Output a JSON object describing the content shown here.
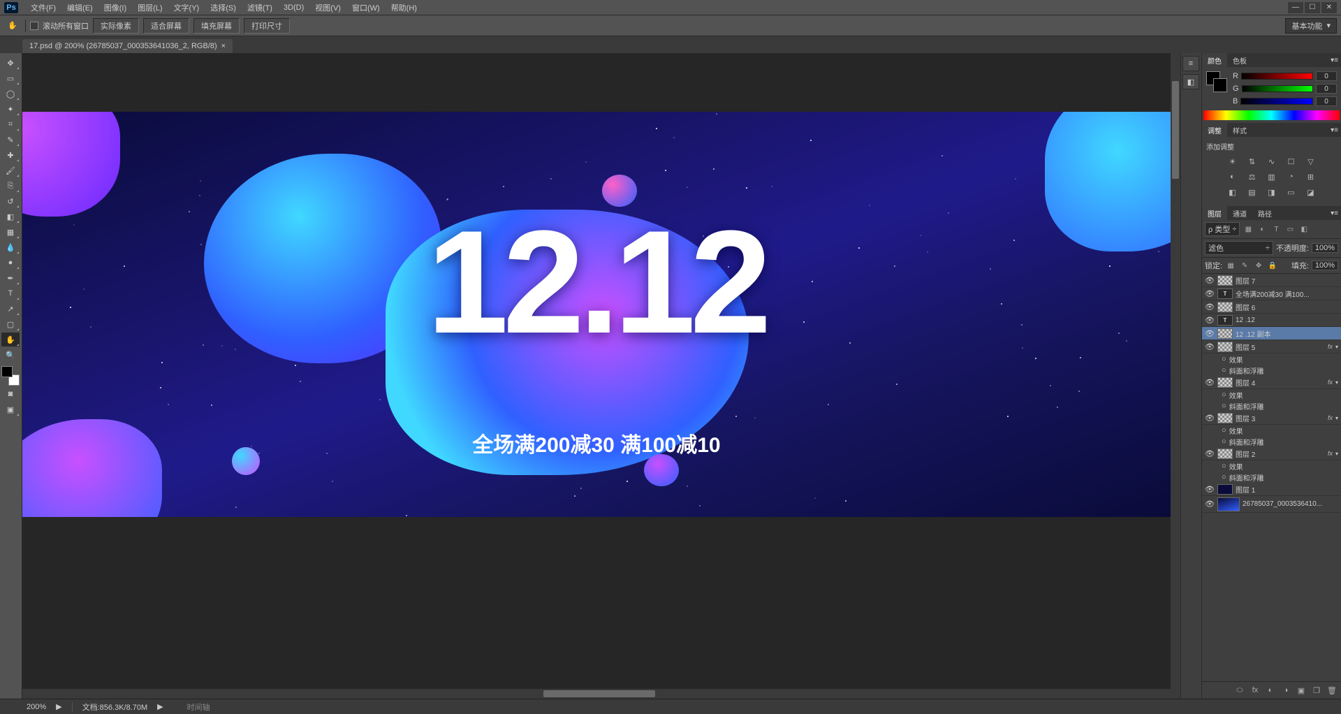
{
  "app": {
    "logo": "Ps"
  },
  "menu": {
    "items": [
      "文件(F)",
      "编辑(E)",
      "图像(I)",
      "图层(L)",
      "文字(Y)",
      "选择(S)",
      "滤镜(T)",
      "3D(D)",
      "视图(V)",
      "窗口(W)",
      "帮助(H)"
    ]
  },
  "window_ctrls": {
    "min": "—",
    "max": "☐",
    "close": "✕"
  },
  "options": {
    "hand_icon": "✋",
    "scroll_all": "滚动所有窗口",
    "buttons": [
      "实际像素",
      "适合屏幕",
      "填充屏幕",
      "打印尺寸"
    ],
    "workspace": "基本功能",
    "caret": "▾"
  },
  "doc_tab": {
    "title": "17.psd @ 200% (26785037_000353641036_2, RGB/8)",
    "close": "×"
  },
  "artwork": {
    "main_text": "12.12",
    "sub_text": "全场满200减30 满100减10"
  },
  "panels": {
    "color": {
      "tab1": "颜色",
      "tab2": "色板",
      "r_label": "R",
      "g_label": "G",
      "b_label": "B",
      "r": "0",
      "g": "0",
      "b": "0"
    },
    "adjust": {
      "tab1": "调整",
      "tab2": "样式",
      "title": "添加调整"
    },
    "layers": {
      "tab1": "图层",
      "tab2": "通道",
      "tab3": "路径",
      "kind": "ρ 类型",
      "blend": "滤色",
      "opacity_label": "不透明度:",
      "opacity": "100%",
      "lock_label": "锁定:",
      "fill_label": "填充:",
      "fill": "100%",
      "items": [
        {
          "name": "图层 7",
          "type": "chk"
        },
        {
          "name": "全场满200减30 满100...",
          "type": "txt"
        },
        {
          "name": "图层 6",
          "type": "chk"
        },
        {
          "name": "12 .12",
          "type": "txt"
        },
        {
          "name": "12 .12 副本",
          "type": "chk-txt",
          "sel": true
        },
        {
          "name": "图层 5",
          "type": "chk",
          "fx": true
        },
        {
          "name": "图层 4",
          "type": "chk",
          "fx": true
        },
        {
          "name": "图层 3",
          "type": "chk",
          "fx": true
        },
        {
          "name": "图层 2",
          "type": "chk",
          "fx": true
        },
        {
          "name": "图层 1",
          "type": "img-solid"
        },
        {
          "name": "26785037_0003536410...",
          "type": "img",
          "bgimg": true
        }
      ],
      "fx_label": "fx",
      "fx_eff": "效果",
      "fx_item": "斜面和浮雕",
      "tri_down": "▾",
      "bullet": "●",
      "circ": "○"
    }
  },
  "status": {
    "zoom": "200%",
    "doc": "文档:856.3K/8.70M",
    "arrow": "▶",
    "time": "时间轴"
  }
}
